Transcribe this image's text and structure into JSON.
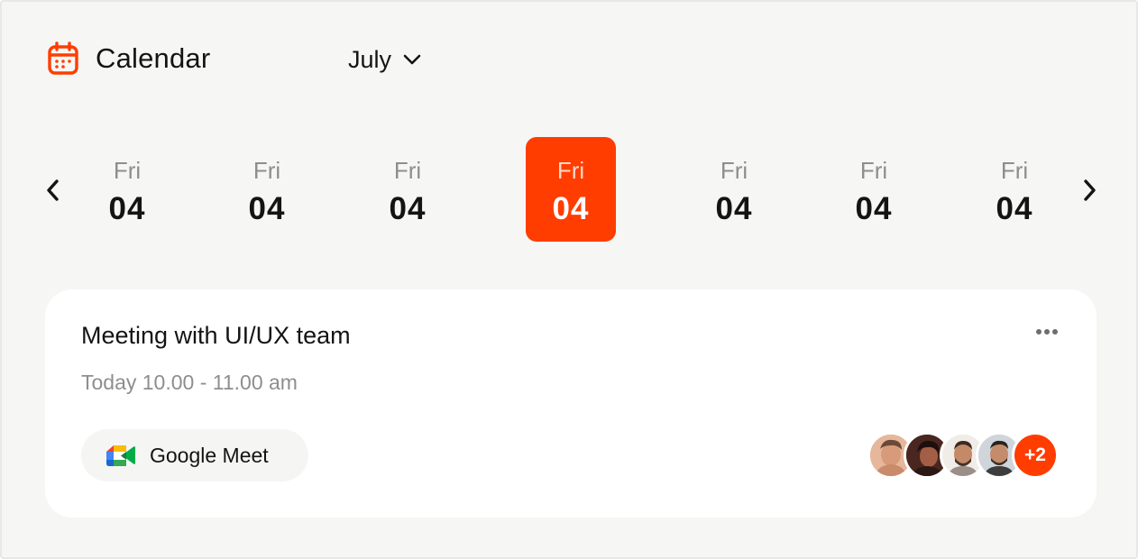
{
  "header": {
    "title": "Calendar",
    "month": "July",
    "accent": "#ff3d00"
  },
  "days": [
    {
      "dow": "Fri",
      "num": "04",
      "selected": false
    },
    {
      "dow": "Fri",
      "num": "04",
      "selected": false
    },
    {
      "dow": "Fri",
      "num": "04",
      "selected": false
    },
    {
      "dow": "Fri",
      "num": "04",
      "selected": true
    },
    {
      "dow": "Fri",
      "num": "04",
      "selected": false
    },
    {
      "dow": "Fri",
      "num": "04",
      "selected": false
    },
    {
      "dow": "Fri",
      "num": "04",
      "selected": false
    }
  ],
  "icons": {
    "calendar": "calendar-icon",
    "month_dropdown": "chevron-down-icon",
    "prev": "chevron-left-icon",
    "next": "chevron-right-icon",
    "more": "more-horizontal-icon",
    "meet": "google-meet-icon"
  },
  "event": {
    "title": "Meeting with UI/UX team",
    "time": "Today 10.00 - 11.00 am",
    "platform": "Google Meet",
    "attendees_extra": "+2",
    "attendee_avatars": [
      "avatar-1",
      "avatar-2",
      "avatar-3",
      "avatar-4"
    ]
  }
}
